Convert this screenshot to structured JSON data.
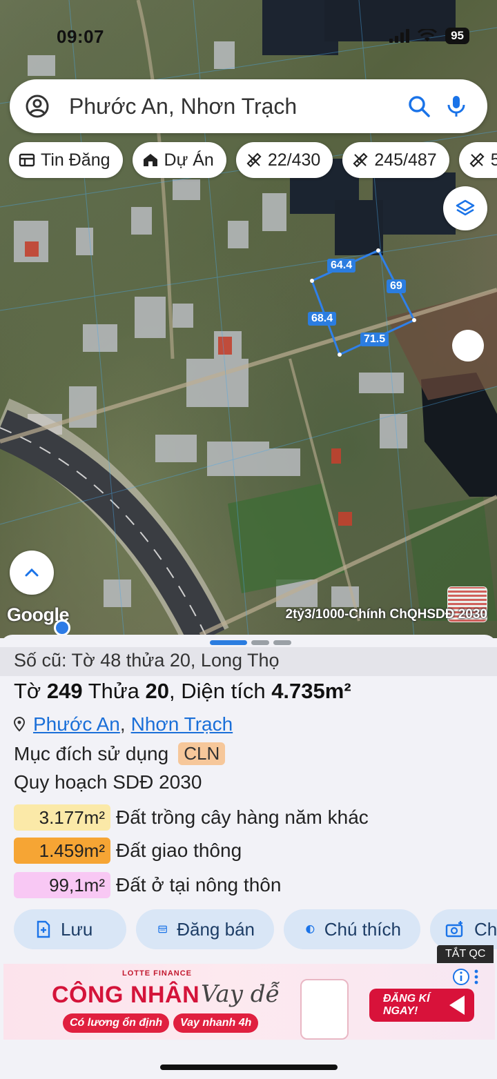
{
  "status_bar": {
    "time": "09:07",
    "battery": "95"
  },
  "search": {
    "query": "Phước An, Nhơn Trạch"
  },
  "chips": [
    {
      "label": "Tin Đăng",
      "icon": "table-icon"
    },
    {
      "label": "Dự Án",
      "icon": "house-icon"
    },
    {
      "label": "22/430",
      "icon": "ruler-icon"
    },
    {
      "label": "245/487",
      "icon": "ruler-icon"
    },
    {
      "label": "5",
      "icon": "ruler-icon"
    }
  ],
  "plot_labels": {
    "top": "64.4",
    "right": "69",
    "left": "68.4",
    "bottom": "71.5"
  },
  "map": {
    "google": "Google",
    "caption": "2tỷ3/1000-Chính ChQHSDĐ 2030"
  },
  "details": {
    "old_ref": "Số cũ: Tờ 48 thửa 20, Long Thọ",
    "title_to_label": "Tờ",
    "title_to_value": "249",
    "title_thua_label": "Thửa",
    "title_thua_value": "20",
    "title_area_label": "Diện tích",
    "title_area_value": "4.735m²",
    "ward": "Phước An",
    "district": "Nhơn Trạch",
    "purpose_label": "Mục đích sử dụng",
    "purpose_code": "CLN",
    "plan_label": "Quy hoạch SDĐ 2030",
    "zones": [
      {
        "area": "3.177m²",
        "name": "Đất trồng cây hàng năm khác",
        "color": "#fbe9a8"
      },
      {
        "area": "1.459m²",
        "name": "Đất giao thông",
        "color": "#f6a534"
      },
      {
        "area": "99,1m²",
        "name": "Đất ở tại nông thôn",
        "color": "#f8c8f4"
      }
    ]
  },
  "actions": [
    {
      "label": "Lưu",
      "icon": "bookmark-plus-icon"
    },
    {
      "label": "Đăng bán",
      "icon": "list-icon"
    },
    {
      "label": "Chú thích",
      "icon": "half-circle-icon"
    },
    {
      "label": "Ch",
      "icon": "camera-plus-icon"
    }
  ],
  "ad": {
    "hide_label": "TẮT QC",
    "brand": "LOTTE FINANCE",
    "headline": "CÔNG NHÂN",
    "script": "Vay dễ",
    "pill_1": "Có lương ổn định",
    "pill_2": "Vay nhanh 4h",
    "cta_1": "ĐĂNG KÍ",
    "cta_2": "NGAY!"
  },
  "colors": {
    "accent": "#2b7de0",
    "link": "#1a6fd8",
    "action_bg": "#d9e6f6"
  }
}
